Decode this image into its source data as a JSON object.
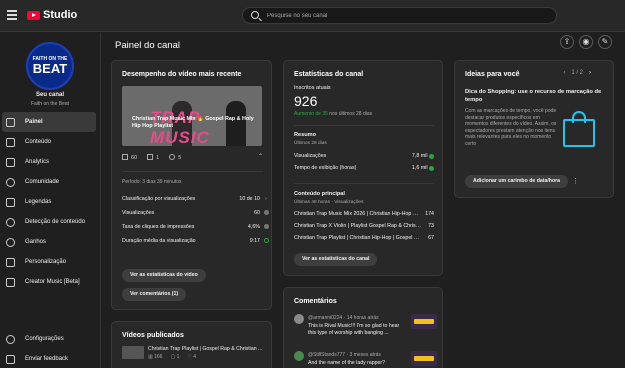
{
  "app": {
    "logo": "Studio",
    "search_placeholder": "Pesquise no seu canal"
  },
  "sidebar": {
    "avatar_line1": "FAITH ON THE",
    "avatar_line2": "BEAT",
    "channel_label": "Seu canal",
    "channel_name": "Faith on the Beat",
    "items": [
      {
        "label": "Painel",
        "icon": "dashboard-icon",
        "active": true
      },
      {
        "label": "Conteúdo",
        "icon": "content-icon"
      },
      {
        "label": "Analytics",
        "icon": "analytics-icon"
      },
      {
        "label": "Comunidade",
        "icon": "community-icon"
      },
      {
        "label": "Legendas",
        "icon": "subtitles-icon"
      },
      {
        "label": "Detecção de conteúdo",
        "icon": "copyright-icon"
      },
      {
        "label": "Ganhos",
        "icon": "earn-icon"
      },
      {
        "label": "Personalização",
        "icon": "customization-icon"
      },
      {
        "label": "Creator Music [Beta]",
        "icon": "music-icon"
      }
    ],
    "bottom": [
      {
        "label": "Configurações",
        "icon": "settings-icon"
      },
      {
        "label": "Enviar feedback",
        "icon": "feedback-icon"
      }
    ]
  },
  "page": {
    "title": "Painel do canal"
  },
  "latest_video": {
    "title": "Desempenho do vídeo mais recente",
    "thumb_big": "TRAP MUSIC",
    "video_title": "Christian Trap Music Mix 🔥 Gospel Rap & Holy Hip Hop Playlist",
    "views": "60",
    "comments": "1",
    "likes": "5",
    "period": "Período: 3 dias 39 minutos",
    "metrics": [
      {
        "label": "Classificação por visualizações",
        "value": "10 de 10",
        "trail": "›"
      },
      {
        "label": "Visualizações",
        "value": "60",
        "trail": "grey"
      },
      {
        "label": "Taxa de cliques de impressões",
        "value": "4,6%",
        "trail": "grey"
      },
      {
        "label": "Duração média da visualização",
        "value": "9:17",
        "trail": "green-outline"
      }
    ],
    "btn_analytics": "Ver as estatísticas do vídeo",
    "btn_comments": "Ver comentários (1)"
  },
  "published": {
    "title": "Vídeos publicados",
    "video_title": "Christian Trap Playlist | Gospel Rap & Christian ...",
    "views": "166",
    "comments": "1",
    "likes": "4"
  },
  "channel_stats": {
    "title": "Estatísticas do canal",
    "subs_label": "Inscritos atuais",
    "subs_value": "926",
    "subs_delta_value": "Aumento de 35",
    "subs_delta_rest": " nos últimos 28 dias",
    "summary_title": "Resumo",
    "summary_sub": "Últimos 28 dias",
    "summary": [
      {
        "label": "Visualizações",
        "value": "7,8 mil"
      },
      {
        "label": "Tempo de exibição (horas)",
        "value": "1,6 mil"
      }
    ],
    "top_title": "Conteúdo principal",
    "top_sub": "Últimas 48 horas · Visualizações",
    "top": [
      {
        "label": "Christian Trap Music Mix 2026 | Christian Hip-Hop | ...",
        "value": "174"
      },
      {
        "label": "Christian Trap X Violin | Playlist Gospel Rap & Christi...",
        "value": "73"
      },
      {
        "label": "Christian Trap Playlist | Christian Hip-Hop | Gospel R...",
        "value": "67"
      }
    ],
    "btn": "Ver as estatísticas do canal"
  },
  "comments": {
    "title": "Comentários",
    "items": [
      {
        "meta": "@armanni0224 · 14 horas atrás",
        "text": "This is Rival Music!!! I'm so glad to hear this type of worship with banging ..."
      },
      {
        "meta": "@StillStands777 · 3 meses atrás",
        "text": "And the name of the lady rapper?"
      }
    ]
  },
  "ideas": {
    "title": "Ideias para você",
    "pager": "1 / 2",
    "idea_title": "Dica do Shopping: use o recurso de marcação de tempo",
    "idea_text": "Com as marcações de tempo, você pode destacar produtos específicos em momentos diferentes do vídeo. Assim, os espectadores prestam atenção nos itens mais relevantes para eles no momento certo",
    "btn": "Adicionar um carimbo de data/hora",
    "more": "⋮"
  },
  "colors": {
    "accent": "#ff0033",
    "positive": "#2ba640",
    "bag": "#22c3ee"
  }
}
